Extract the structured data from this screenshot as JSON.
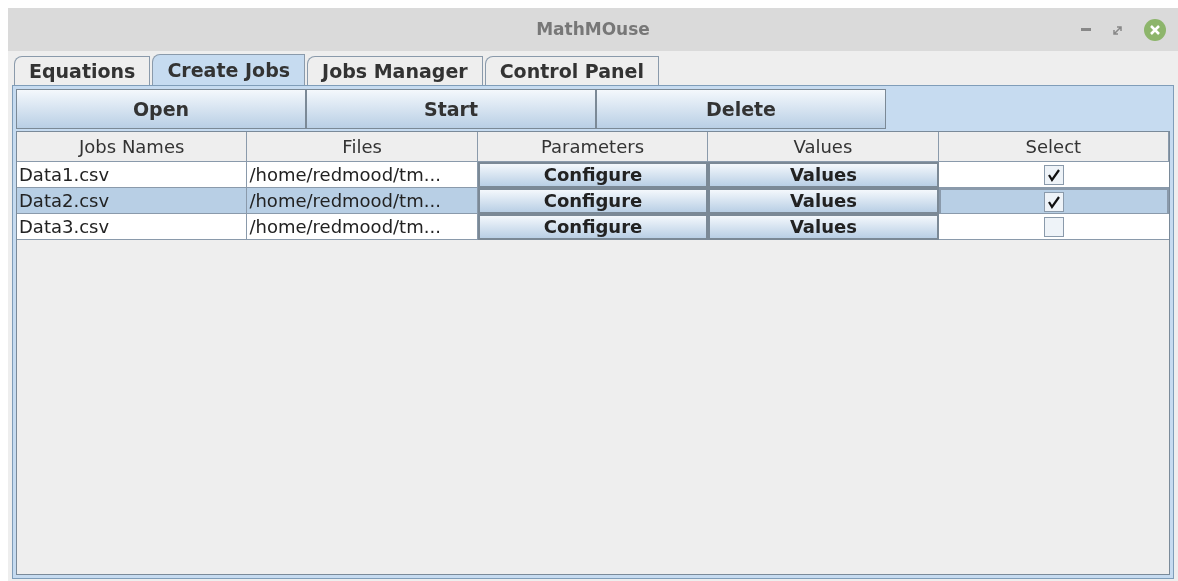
{
  "window": {
    "title": "MathMOuse"
  },
  "tabs": [
    {
      "label": "Equations",
      "selected": false
    },
    {
      "label": "Create Jobs",
      "selected": true
    },
    {
      "label": "Jobs Manager",
      "selected": false
    },
    {
      "label": "Control Panel",
      "selected": false
    }
  ],
  "toolbar": [
    "Open",
    "Start",
    "Delete"
  ],
  "table": {
    "columns": [
      "Jobs Names",
      "Files",
      "Parameters",
      "Values",
      "Select"
    ],
    "rows": [
      {
        "name": "Data1.csv",
        "file": "/home/redmood/tm...",
        "parameters": "Configure",
        "values": "Values",
        "checked": true,
        "selected": false
      },
      {
        "name": "Data2.csv",
        "file": "/home/redmood/tm...",
        "parameters": "Configure",
        "values": "Values",
        "checked": true,
        "selected": true
      },
      {
        "name": "Data3.csv",
        "file": "/home/redmood/tm...",
        "parameters": "Configure",
        "values": "Values",
        "checked": false,
        "selected": false
      }
    ]
  }
}
